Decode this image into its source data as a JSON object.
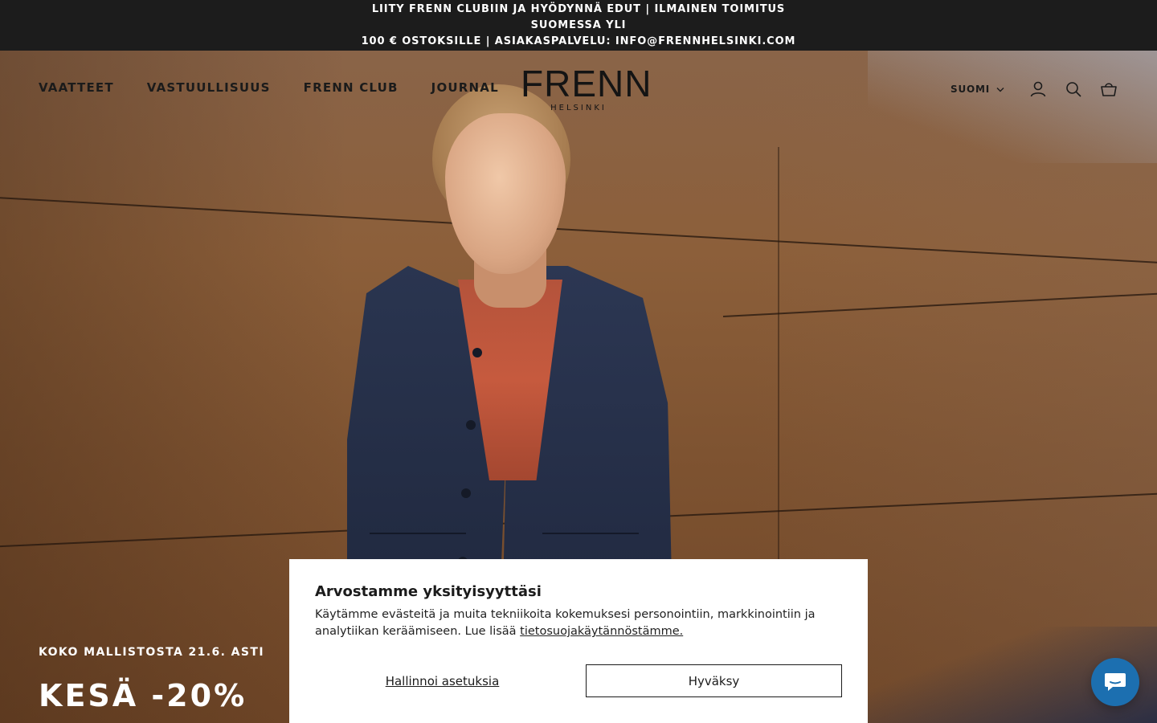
{
  "announcement": {
    "line1": "LIITY FRENN CLUBIIN JA HYÖDYNNÄ EDUT | ILMAINEN TOIMITUS SUOMESSA YLI",
    "line2": "100 € OSTOKSILLE | ASIAKASPALVELU: INFO@FRENNHELSINKI.COM"
  },
  "header": {
    "nav": [
      {
        "label": "VAATTEET"
      },
      {
        "label": "VASTUULLISUUS"
      },
      {
        "label": "FRENN CLUB"
      },
      {
        "label": "JOURNAL"
      }
    ],
    "logo": {
      "word": "FRENN",
      "sub": "HELSINKI"
    },
    "language": {
      "label": "SUOMI",
      "icon": "chevron-down-icon"
    },
    "icons": [
      "account-icon",
      "search-icon",
      "cart-icon"
    ]
  },
  "hero": {
    "eyebrow": "KOKO MALLISTOSTA 21.6. ASTI",
    "headline": "KESÄ -20%"
  },
  "cookie_banner": {
    "title": "Arvostamme yksityisyyttäsi",
    "body": "Käytämme evästeitä ja muita tekniikoita kokemuksesi personointiin, markkinointiin ja analytiikan keräämiseen. Lue lisää ",
    "link": "tietosuojakäytännöstämme.",
    "manage_label": "Hallinnoi asetuksia",
    "accept_label": "Hyväksy"
  },
  "chat": {
    "icon": "chat-icon"
  },
  "colors": {
    "announcement_bg": "#1c1c1c",
    "text_dark": "#1b1b1b",
    "chat_blue": "#1c6fb0"
  }
}
